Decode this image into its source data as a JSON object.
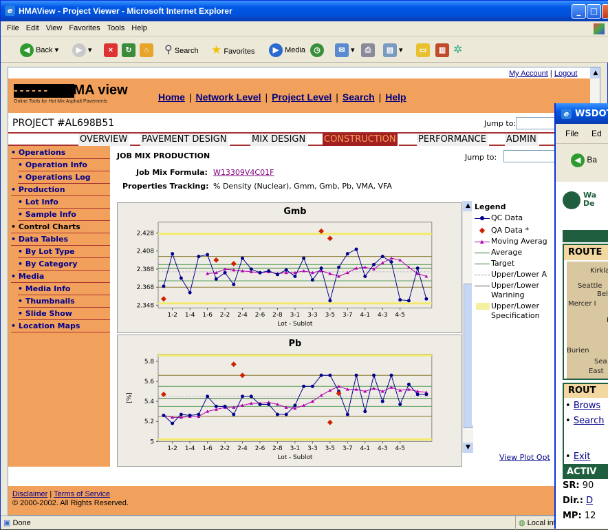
{
  "window": {
    "title": "HMAView - Project Viewer - Microsoft Internet Explorer"
  },
  "menu": [
    "File",
    "Edit",
    "View",
    "Favorites",
    "Tools",
    "Help"
  ],
  "toolbar": {
    "back": "Back",
    "search": "Search",
    "favorites": "Favorites",
    "media": "Media"
  },
  "status": {
    "left": "Done",
    "zone": "Local int"
  },
  "site": {
    "my_account": "My Account",
    "logout": "Logout",
    "logo_brand": "HMA view",
    "logo_tagline": "Online Tools for Hot Mix Asphalt Pavements",
    "nav": [
      "Home",
      "Network Level",
      "Project Level",
      "Search",
      "Help"
    ],
    "project": "PROJECT #AL698B51",
    "jump_to": "Jump to:",
    "tabs": [
      "OVERVIEW",
      "PAVEMENT DESIGN",
      "MIX DESIGN",
      "CONSTRUCTION",
      "PERFORMANCE",
      "ADMIN"
    ],
    "active_tab": "CONSTRUCTION"
  },
  "sidebar": [
    {
      "label": "• Operations",
      "level": 0
    },
    {
      "label": "• Operation Info",
      "level": 1
    },
    {
      "label": "• Operations Log",
      "level": 1
    },
    {
      "label": "• Production",
      "level": 0
    },
    {
      "label": "• Lot Info",
      "level": 1
    },
    {
      "label": "• Sample Info",
      "level": 1
    },
    {
      "label": "• Control Charts",
      "level": 0,
      "current": true
    },
    {
      "label": "• Data Tables",
      "level": 0
    },
    {
      "label": "• By Lot Type",
      "level": 1
    },
    {
      "label": "• By Category",
      "level": 1
    },
    {
      "label": "• Media",
      "level": 0
    },
    {
      "label": "• Media Info",
      "level": 1
    },
    {
      "label": "• Thumbnails",
      "level": 1
    },
    {
      "label": "• Slide Show",
      "level": 1
    },
    {
      "label": "• Location Maps",
      "level": 0
    }
  ],
  "content": {
    "heading": "JOB MIX PRODUCTION",
    "jump_to": "Jump to:",
    "jmf_label": "Job Mix Formula:",
    "jmf_value": "W13309V4C01F",
    "props_label": "Properties Tracking:",
    "props_value": "% Density (Nuclear), Gmm, Gmb, Pb, VMA, VFA",
    "view_plot": "View Plot Opt"
  },
  "legend": {
    "title": "Legend",
    "items": [
      "QC Data",
      "QA Data *",
      "Moving Averag",
      "Average",
      "Target",
      "Upper/Lower A",
      "Upper/Lower",
      "Warining",
      "Upper/Lower",
      "Specification"
    ]
  },
  "footer": {
    "disclaimer": "Disclaimer",
    "terms": "Terms of Service",
    "copyright": "© 2000-2002. All Rights Reserved."
  },
  "popup": {
    "title": "WSDOT",
    "menu_file": "File",
    "menu_edit": "Ed",
    "back": "Ba",
    "logo_text1": "Wa",
    "logo_text2": "De",
    "route_hdr": "ROUTE",
    "map_labels": [
      "Kirklar",
      "Seattle",
      "Bell",
      "Mercer I",
      "Kin",
      "Burien",
      "Sea",
      "East"
    ],
    "rout_hdr": "ROUT",
    "browse": "Brows",
    "search": "Search",
    "exit": "Exit",
    "activ": "ACTIV",
    "sr_label": "SR:",
    "sr_value": "90",
    "dir_label": "Dir.:",
    "dir_value": "D",
    "mp_label": "MP:",
    "mp_value": "12"
  },
  "colors": {
    "orange": "#f2a15c",
    "maroon": "#a31f1f",
    "navy": "#00008b",
    "qc": "#00008b",
    "qa": "#cc2200",
    "moving": "#b000b0"
  },
  "chart_data": [
    {
      "type": "line",
      "title": "Gmb",
      "xlabel": "Lot - Sublot",
      "ylabel": "",
      "x_ticks": [
        "1-2",
        "1-4",
        "1-6",
        "2-2",
        "2-4",
        "2-6",
        "2-8",
        "3-1",
        "3-3",
        "3-5",
        "3-7",
        "4-1",
        "4-3",
        "4-5"
      ],
      "y_ticks": [
        2.348,
        2.368,
        2.388,
        2.408,
        2.428
      ],
      "ylim": [
        2.345,
        2.44
      ],
      "series": [
        {
          "name": "QC Data",
          "values": [
            2.369,
            2.405,
            2.378,
            2.362,
            2.402,
            2.404,
            2.377,
            2.384,
            2.371,
            2.4,
            2.388,
            2.384,
            2.386,
            2.382,
            2.387,
            2.38,
            2.4,
            2.376,
            2.389,
            2.353,
            2.39,
            2.405,
            2.41,
            2.38,
            2.393,
            2.402,
            2.396,
            2.354,
            2.353,
            2.389,
            2.355
          ]
        },
        {
          "name": "QA Data *",
          "points": [
            [
              0,
              2.355
            ],
            [
              6,
              2.398
            ],
            [
              8,
              2.394
            ],
            [
              18,
              2.43
            ],
            [
              19,
              2.422
            ]
          ]
        },
        {
          "name": "Moving Averag",
          "values": [
            null,
            null,
            null,
            null,
            null,
            2.383,
            2.384,
            2.388,
            2.387,
            2.386,
            2.385,
            2.384,
            2.385,
            2.383,
            2.384,
            2.384,
            2.386,
            2.384,
            2.386,
            2.383,
            2.38,
            2.384,
            2.389,
            2.39,
            2.388,
            2.395,
            2.4,
            2.398,
            2.39,
            2.383,
            2.38
          ]
        }
      ],
      "lines": {
        "average": 2.389,
        "target": 2.385,
        "warning": [
          2.375,
          2.393
        ],
        "action": [
          2.368,
          2.402
        ],
        "spec": [
          2.35,
          2.427
        ]
      },
      "grid": true
    },
    {
      "type": "line",
      "title": "Pb",
      "xlabel": "Lot - Sublot",
      "ylabel": "[%]",
      "x_ticks": [
        "1-2",
        "1-4",
        "1-6",
        "2-2",
        "2-4",
        "2-6",
        "2-8",
        "3-1",
        "3-3",
        "3-5",
        "3-7",
        "4-1",
        "4-3",
        "4-5"
      ],
      "y_ticks": [
        5.0,
        5.2,
        5.4,
        5.6,
        5.8
      ],
      "ylim": [
        5.0,
        5.87
      ],
      "series": [
        {
          "name": "QC Data",
          "values": [
            5.26,
            5.18,
            5.27,
            5.26,
            5.27,
            5.45,
            5.35,
            5.35,
            5.27,
            5.45,
            5.45,
            5.37,
            5.37,
            5.27,
            5.27,
            5.36,
            5.55,
            5.55,
            5.66,
            5.66,
            5.5,
            5.27,
            5.66,
            5.3,
            5.66,
            5.4,
            5.66,
            5.37,
            5.57,
            5.47,
            5.47
          ]
        },
        {
          "name": "QA Data *",
          "points": [
            [
              0,
              5.47
            ],
            [
              8,
              5.77
            ],
            [
              9,
              5.66
            ],
            [
              20,
              5.48
            ],
            [
              19,
              5.19
            ]
          ]
        },
        {
          "name": "Moving Averag",
          "values": [
            5.26,
            5.24,
            5.24,
            5.25,
            5.25,
            5.3,
            5.32,
            5.34,
            5.34,
            5.36,
            5.38,
            5.38,
            5.39,
            5.37,
            5.34,
            5.33,
            5.36,
            5.4,
            5.46,
            5.51,
            5.55,
            5.52,
            5.52,
            5.5,
            5.53,
            5.5,
            5.54,
            5.51,
            5.52,
            5.5,
            5.49
          ]
        }
      ],
      "lines": {
        "average": 5.43,
        "target": 5.45,
        "warning": [
          5.35,
          5.55
        ],
        "action": [
          5.25,
          5.66
        ],
        "spec": [
          5.02,
          5.86
        ]
      },
      "grid": true
    }
  ]
}
